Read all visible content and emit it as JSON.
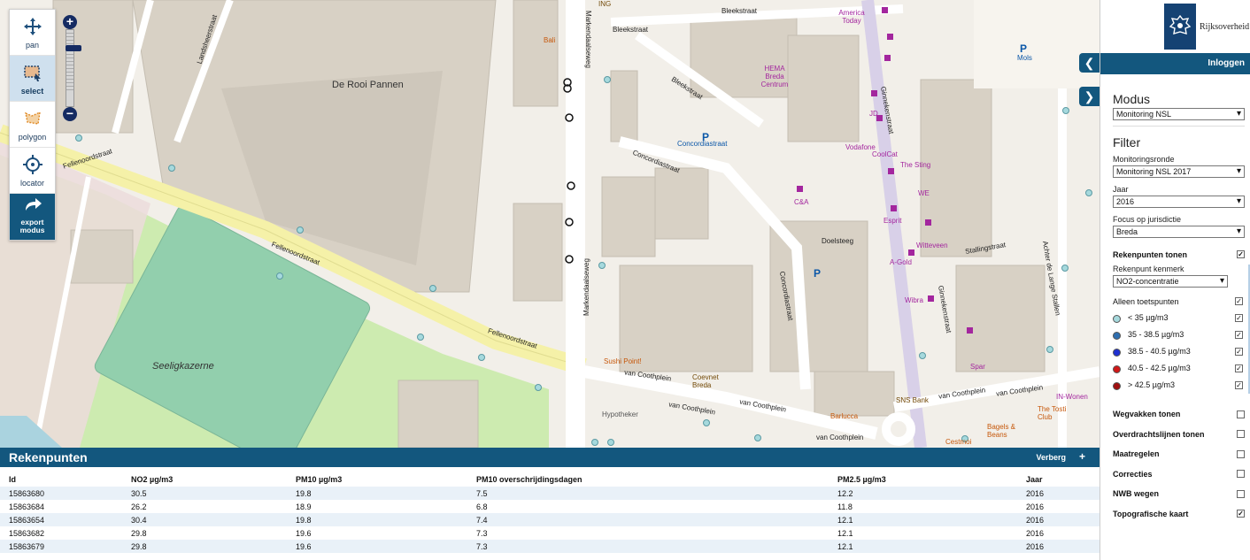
{
  "toolbar": {
    "pan": "pan",
    "select": "select",
    "polygon": "polygon",
    "locator": "locator",
    "export": "export modus"
  },
  "map_labels": {
    "de_rooi_pannen": "De Rooi Pannen",
    "seeligkazerne": "Seeligkazerne",
    "fellenoordstraat": "Fellenoordstraat",
    "markendaalseweg": "Markendaalseweg",
    "bleekstraat": "Bleekstraat",
    "concordiastraat": "Concordiastraat",
    "concordiastraat_p": "Concordiastraat",
    "doelsteeg": "Doelsteeg",
    "stallingstraat": "Stallingstraat",
    "ginnekenstraat": "Ginnekenstraat",
    "van_coothplein": "van Coothplein",
    "landsheerstraat": "Landsheerstraat",
    "achter_de_lange_stallen": "Achter de Lange Stallen",
    "hema": "HEMA Breda Centrum",
    "america_today": "America Today",
    "vodafone": "Vodafone",
    "coolcat": "CoolCat",
    "the_sting": "The Sting",
    "witteveen": "Witteveen",
    "esprit": "Esprit",
    "wibra": "Wibra",
    "a_gold": "A-Gold",
    "we": "WE",
    "ca": "C&A",
    "jd": "JD",
    "spar": "Spar",
    "sns": "SNS Bank",
    "sushi": "Sushi Point!",
    "hypotheker": "Hypotheker",
    "bali": "Bali",
    "mols": "Mols",
    "ing": "ING",
    "the_tosti_club": "The Tosti Club",
    "in_wonen": "IN-Wonen",
    "bagels": "Bagels & Beans",
    "barlucca": "Barlucca",
    "corneret": "Coevnet Breda",
    "cestmoi": "Cestmoi"
  },
  "sidebar": {
    "brand": "Rijksoverheid",
    "login": "Inloggen",
    "modus_title": "Modus",
    "modus_value": "Monitoring NSL",
    "filter_title": "Filter",
    "monitoringsronde_label": "Monitoringsronde",
    "monitoringsronde_value": "Monitoring NSL 2017",
    "jaar_label": "Jaar",
    "jaar_value": "2016",
    "focus_label": "Focus op jurisdictie",
    "focus_value": "Breda",
    "rekenpunten_tonen": "Rekenpunten tonen",
    "kenmerk_label": "Rekenpunt kenmerk",
    "kenmerk_value": "NO2-concentratie",
    "alleen_toetspunten": "Alleen toetspunten",
    "legend": [
      {
        "label": "< 35 µg/m3",
        "color": "#a6d9dd"
      },
      {
        "label": "35 - 38.5 µg/m3",
        "color": "#2f6fb0"
      },
      {
        "label": "38.5 - 40.5 µg/m3",
        "color": "#1f2fd0"
      },
      {
        "label": "40.5 - 42.5 µg/m3",
        "color": "#d01818"
      },
      {
        "label": "> 42.5 µg/m3",
        "color": "#a01010"
      }
    ],
    "layers": [
      {
        "label": "Wegvakken tonen",
        "checked": false
      },
      {
        "label": "Overdrachtslijnen tonen",
        "checked": false
      },
      {
        "label": "Maatregelen",
        "checked": false
      },
      {
        "label": "Correcties",
        "checked": false
      },
      {
        "label": "NWB wegen",
        "checked": false
      },
      {
        "label": "Topografische kaart",
        "checked": true
      }
    ]
  },
  "panel": {
    "title": "Rekenpunten",
    "hide": "Verberg",
    "plus": "+",
    "columns": [
      "Id",
      "NO2 µg/m3",
      "PM10 µg/m3",
      "PM10 overschrijdingsdagen",
      "PM2.5 µg/m3",
      "Jaar"
    ],
    "rows": [
      [
        "15863680",
        "30.5",
        "19.8",
        "7.5",
        "12.2",
        "2016"
      ],
      [
        "15863684",
        "26.2",
        "18.9",
        "6.8",
        "11.8",
        "2016"
      ],
      [
        "15863654",
        "30.4",
        "19.8",
        "7.4",
        "12.1",
        "2016"
      ],
      [
        "15863682",
        "29.8",
        "19.6",
        "7.3",
        "12.1",
        "2016"
      ],
      [
        "15863679",
        "29.8",
        "19.6",
        "7.3",
        "12.1",
        "2016"
      ]
    ]
  }
}
